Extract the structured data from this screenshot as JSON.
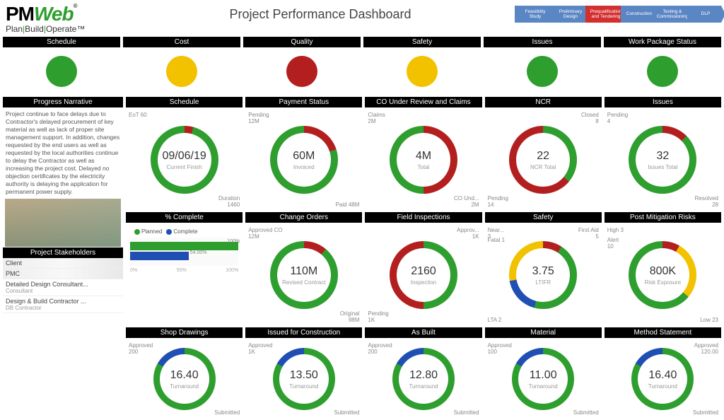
{
  "header": {
    "logo_text1": "PM",
    "logo_text2": "Web",
    "logo_reg": "®",
    "tagline_a": "Plan",
    "tagline_b": "Build",
    "tagline_c": "Operate",
    "tagline_tm": "™",
    "title": "Project Performance Dashboard",
    "phases": [
      "Feasibility Study",
      "Preliminary Design",
      "Prequalification and Tendering",
      "Construction",
      "Testing & Commissioning",
      "DLP"
    ],
    "phase_active_index": 2
  },
  "status_row": {
    "headers": [
      "Schedule",
      "Cost",
      "Quality",
      "Safety",
      "Issues",
      "Work Package Status"
    ],
    "colors": [
      "green",
      "yellow",
      "red",
      "yellow",
      "green",
      "green"
    ]
  },
  "left": {
    "narr_hdr": "Progress Narrative",
    "narr_text": "Project continue to face delays due to Contractor's delayed procurement of key material as well as lack of proper site management support. In addition, changes requested by the end users as well as requested by the local authorities continue to delay the Contractor as well as increasing the project cost. Delayed no objection certificates by the electricity authority is delaying the application for permanent power supply.",
    "stk_hdr": "Project Stakeholders",
    "stakeholders": [
      {
        "a": "Client",
        "b": "",
        "marble": true
      },
      {
        "a": "PMC",
        "b": "",
        "marble": true
      },
      {
        "a": "Detailed Design Consultant...",
        "b": "Consultant",
        "marble": false
      },
      {
        "a": "Design & Build Contractor ...",
        "b": "DB Contractor",
        "marble": false
      }
    ]
  },
  "row1_headers": [
    "Schedule",
    "Payment Status",
    "CO Under Review and Claims",
    "NCR",
    "Issues"
  ],
  "row2_headers": [
    "% Complete",
    "Change Orders",
    "Field Inspections",
    "Safety",
    "Post Mitigation Risks"
  ],
  "row3_headers": [
    "Shop Drawings",
    "Issued for Construction",
    "As Built",
    "Material",
    "Method Statement"
  ],
  "donuts": {
    "schedule": {
      "val": "09/06/19",
      "lbl": "Current Finish",
      "tl": "EoT 60",
      "br": "Duration\n1460"
    },
    "payment": {
      "val": "60M",
      "lbl": "Invoiced",
      "tl": "Pending\n12M",
      "br": "Paid 48M"
    },
    "co": {
      "val": "4M",
      "lbl": "Total",
      "tl": "Claims\n2M",
      "br": "CO Und...\n2M"
    },
    "ncr": {
      "val": "22",
      "lbl": "NCR Total",
      "tr": "Closed\n8",
      "bl": "Pending\n14"
    },
    "issues": {
      "val": "32",
      "lbl": "Issues Total",
      "tl": "Pending\n4",
      "br": "Resolved\n28"
    },
    "change": {
      "val": "110M",
      "lbl": "Revised Contract",
      "tl": "Approved CO\n12M",
      "br": "Original\n98M"
    },
    "field": {
      "val": "2160",
      "lbl": "Inspection",
      "tr": "Approv...\n1K",
      "bl": "Pending\n1K"
    },
    "safety": {
      "val": "3.75",
      "lbl": "LTIFR",
      "tl2": "Fatal 1",
      "tl": "Near...\n3",
      "tr": "First Aid\n5",
      "bl": "LTA 2"
    },
    "risk": {
      "val": "800K",
      "lbl": "Risk Exposure",
      "tl": "High 3",
      "tl2": "Alert\n10",
      "br": "Low 23"
    },
    "shop": {
      "val": "16.40",
      "lbl": "Turnaround",
      "tl": "Approved\n200",
      "br": "Submitted"
    },
    "ifc": {
      "val": "13.50",
      "lbl": "Turnaround",
      "tl": "Approved\n1K",
      "br": "Submitted"
    },
    "asbuilt": {
      "val": "12.80",
      "lbl": "Turnaround",
      "tl": "Approved\n200",
      "br": "Submitted"
    },
    "material": {
      "val": "11.00",
      "lbl": "Turnaround",
      "tl": "Approved\n100",
      "br": "Submitted"
    },
    "method": {
      "val": "16.40",
      "lbl": "Turnaround",
      "tr": "Approved\n120.00",
      "br": "Submitted"
    }
  },
  "pct_complete": {
    "legend_a": "Planned",
    "legend_b": "Complete",
    "planned": 100,
    "complete": 54,
    "label_a": "100%",
    "label_b": "54.00%",
    "axis": [
      "0%",
      "50%",
      "100%"
    ]
  },
  "chart_data": [
    {
      "type": "donut",
      "title": "Schedule",
      "center": "09/06/19",
      "center_label": "Current Finish",
      "series": [
        {
          "name": "EoT",
          "value": 60,
          "color": "#b31f1f"
        },
        {
          "name": "Duration",
          "value": 1460,
          "color": "#2e9e2e"
        }
      ]
    },
    {
      "type": "donut",
      "title": "Payment Status",
      "center": "60M",
      "center_label": "Invoiced",
      "series": [
        {
          "name": "Pending",
          "value": 12,
          "color": "#b31f1f"
        },
        {
          "name": "Paid",
          "value": 48,
          "color": "#2e9e2e"
        }
      ],
      "unit": "M"
    },
    {
      "type": "donut",
      "title": "CO Under Review and Claims",
      "center": "4M",
      "center_label": "Total",
      "series": [
        {
          "name": "Claims",
          "value": 2,
          "color": "#b31f1f"
        },
        {
          "name": "CO Under Review",
          "value": 2,
          "color": "#2e9e2e"
        }
      ],
      "unit": "M"
    },
    {
      "type": "donut",
      "title": "NCR",
      "center": "22",
      "center_label": "NCR Total",
      "series": [
        {
          "name": "Pending",
          "value": 14,
          "color": "#b31f1f"
        },
        {
          "name": "Closed",
          "value": 8,
          "color": "#2e9e2e"
        }
      ]
    },
    {
      "type": "donut",
      "title": "Issues",
      "center": "32",
      "center_label": "Issues Total",
      "series": [
        {
          "name": "Pending",
          "value": 4,
          "color": "#b31f1f"
        },
        {
          "name": "Resolved",
          "value": 28,
          "color": "#2e9e2e"
        }
      ]
    },
    {
      "type": "bar",
      "title": "% Complete",
      "categories": [
        "Planned",
        "Complete"
      ],
      "values": [
        100,
        54
      ],
      "xlabel": "",
      "ylabel": "",
      "ylim": [
        0,
        100
      ]
    },
    {
      "type": "donut",
      "title": "Change Orders",
      "center": "110M",
      "center_label": "Revised Contract",
      "series": [
        {
          "name": "Approved CO",
          "value": 12,
          "color": "#b31f1f"
        },
        {
          "name": "Original",
          "value": 98,
          "color": "#2e9e2e"
        }
      ],
      "unit": "M"
    },
    {
      "type": "donut",
      "title": "Field Inspections",
      "center": "2160",
      "center_label": "Inspection",
      "series": [
        {
          "name": "Approved",
          "value": 1000,
          "color": "#2e9e2e"
        },
        {
          "name": "Pending",
          "value": 1000,
          "color": "#b31f1f"
        }
      ]
    },
    {
      "type": "donut",
      "title": "Safety",
      "center": "3.75",
      "center_label": "LTIFR",
      "series": [
        {
          "name": "Fatal",
          "value": 1,
          "color": "#b31f1f"
        },
        {
          "name": "First Aid",
          "value": 5,
          "color": "#2e9e2e"
        },
        {
          "name": "LTA",
          "value": 2,
          "color": "#1f4fb3"
        },
        {
          "name": "Near Miss",
          "value": 3,
          "color": "#f2c200"
        }
      ]
    },
    {
      "type": "donut",
      "title": "Post Mitigation Risks",
      "center": "800K",
      "center_label": "Risk Exposure",
      "series": [
        {
          "name": "High",
          "value": 3,
          "color": "#b31f1f"
        },
        {
          "name": "Alert",
          "value": 10,
          "color": "#f2c200"
        },
        {
          "name": "Low",
          "value": 23,
          "color": "#2e9e2e"
        }
      ]
    },
    {
      "type": "donut",
      "title": "Shop Drawings",
      "center": "16.40",
      "center_label": "Turnaround",
      "series": [
        {
          "name": "Approved",
          "value": 200,
          "color": "#2e9e2e"
        },
        {
          "name": "Submitted",
          "value": 40,
          "color": "#1f4fb3"
        }
      ]
    },
    {
      "type": "donut",
      "title": "Issued for Construction",
      "center": "13.50",
      "center_label": "Turnaround",
      "series": [
        {
          "name": "Approved",
          "value": 1000,
          "color": "#2e9e2e"
        },
        {
          "name": "Submitted",
          "value": 150,
          "color": "#1f4fb3"
        }
      ]
    },
    {
      "type": "donut",
      "title": "As Built",
      "center": "12.80",
      "center_label": "Turnaround",
      "series": [
        {
          "name": "Approved",
          "value": 200,
          "color": "#2e9e2e"
        },
        {
          "name": "Submitted",
          "value": 30,
          "color": "#1f4fb3"
        }
      ]
    },
    {
      "type": "donut",
      "title": "Material",
      "center": "11.00",
      "center_label": "Turnaround",
      "series": [
        {
          "name": "Approved",
          "value": 100,
          "color": "#2e9e2e"
        },
        {
          "name": "Submitted",
          "value": 15,
          "color": "#1f4fb3"
        }
      ]
    },
    {
      "type": "donut",
      "title": "Method Statement",
      "center": "16.40",
      "center_label": "Turnaround",
      "series": [
        {
          "name": "Approved",
          "value": 120,
          "color": "#2e9e2e"
        },
        {
          "name": "Submitted",
          "value": 20,
          "color": "#1f4fb3"
        }
      ]
    }
  ]
}
